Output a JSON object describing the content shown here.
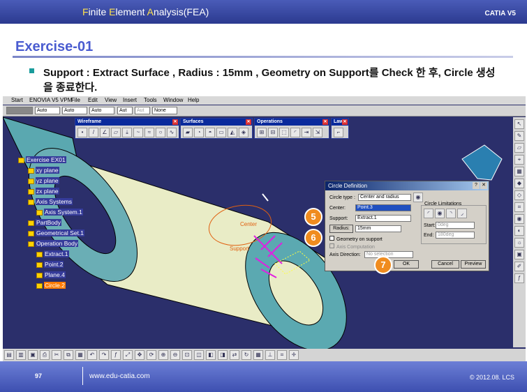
{
  "header": {
    "title_F": "F",
    "title_1": "inite ",
    "title_E": "E",
    "title_2": "lement ",
    "title_A": "A",
    "title_3": "nalysis(FEA)",
    "brand": "CATIA V5"
  },
  "slide": {
    "title": "Exercise-01",
    "bullet": "Support : Extract Surface , Radius : 15mm , Geometry on Support를 Check 한 후, Circle 생성을 종료한다."
  },
  "menu": [
    "Start",
    "ENOVIA V5 VPM",
    "File",
    "Edit",
    "View",
    "Insert",
    "Tools",
    "Window",
    "Help"
  ],
  "format_bar": [
    "Auto",
    "Auto",
    "Auto",
    "Aut",
    "Aut",
    "None"
  ],
  "toolbars": [
    {
      "name": "Wireframe"
    },
    {
      "name": "Surfaces"
    },
    {
      "name": "Operations"
    },
    {
      "name": "Law"
    }
  ],
  "tree": [
    {
      "label": "Exercise EX01"
    },
    {
      "label": "xy plane"
    },
    {
      "label": "yz plane"
    },
    {
      "label": "zx plane"
    },
    {
      "label": "Axis Systems"
    },
    {
      "label": "Axis System.1"
    },
    {
      "label": "PartBody"
    },
    {
      "label": "Geometrical Set.1"
    },
    {
      "label": "Operation Body"
    },
    {
      "label": "Extract.1"
    },
    {
      "label": "Point.2"
    },
    {
      "label": "Plane.4"
    },
    {
      "label": "Circle.2"
    }
  ],
  "canvas_labels": {
    "center": "Center",
    "support": "Support"
  },
  "dialog": {
    "title": "Circle Definition",
    "circle_type_label": "Circle type :",
    "circle_type_value": "Center and radius",
    "center_label": "Center:",
    "center_value": "Point.3",
    "support_label": "Support:",
    "support_value": "Extract.1",
    "radius_label": "Radius:",
    "radius_value": "15mm",
    "geometry_on_support": "Geometry on support",
    "axis_computation": "Axis Computation",
    "axis_direction_label": "Axis Direction:",
    "axis_direction_value": "No selection",
    "limitations_label": "Circle Limitations",
    "start_label": "Start:",
    "start_value": "0deg",
    "end_label": "End:",
    "end_value": "180deg",
    "ok": "OK",
    "cancel": "Cancel",
    "preview": "Preview"
  },
  "badges": [
    "5",
    "6",
    "7"
  ],
  "footer": {
    "page": "97",
    "url": "www.edu-catia.com",
    "copyright": "© 2012.08. LCS"
  }
}
